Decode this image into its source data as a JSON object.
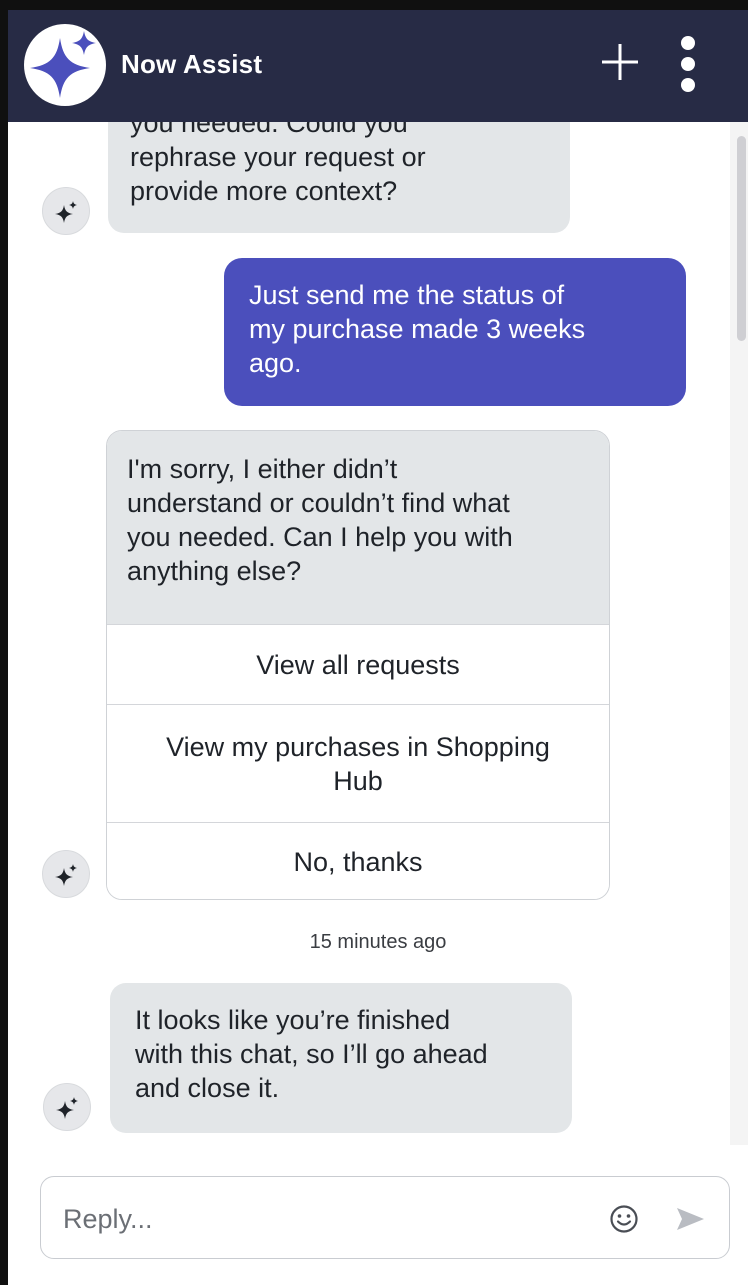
{
  "header": {
    "title": "Now Assist",
    "logo_icon": "sparkle-icon",
    "new_chat_icon": "plus-icon",
    "more_icon": "more-vertical-icon",
    "background": "#272b45"
  },
  "messages": {
    "bot_partial": {
      "lines": [
        "you needed. Could you",
        "rephrase your request or",
        "provide more context?"
      ]
    },
    "user_1": {
      "lines": [
        "Just send me the status of",
        "my purchase made 3 weeks",
        "ago."
      ]
    },
    "bot_card": {
      "lines": [
        "I'm sorry, I either didn’t",
        "understand or couldn’t find what",
        "you needed. Can I help you with",
        "anything else?"
      ],
      "options": [
        {
          "lines": [
            "View all requests"
          ]
        },
        {
          "lines": [
            "View my purchases in Shopping",
            "Hub"
          ]
        },
        {
          "lines": [
            "No, thanks"
          ]
        }
      ]
    },
    "timestamp": "15 minutes ago",
    "bot_close": {
      "lines": [
        "It looks like you’re finished",
        "with this chat, so I’ll go ahead",
        "and close it."
      ]
    }
  },
  "composer": {
    "placeholder": "Reply...",
    "emoji_icon": "emoji-icon",
    "send_icon": "send-icon"
  },
  "colors": {
    "accent": "#4b4fbc",
    "bot_bubble": "#e3e6e8"
  }
}
